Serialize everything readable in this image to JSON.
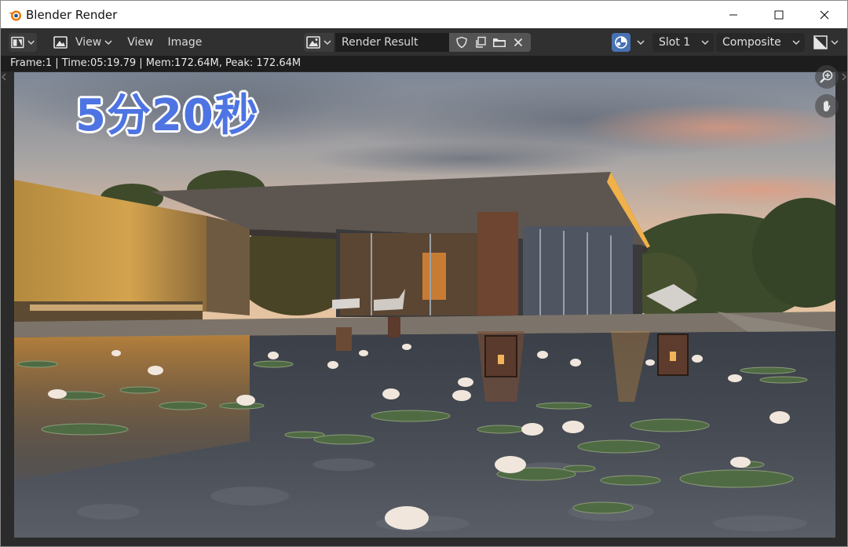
{
  "window": {
    "title": "Blender Render"
  },
  "header": {
    "menus": {
      "view1": "View",
      "view2": "View",
      "image": "Image"
    },
    "image_name": "Render Result",
    "slot": "Slot 1",
    "pass": "Composite"
  },
  "info": {
    "text": "Frame:1 | Time:05:19.79 | Mem:172.64M, Peak: 172.64M"
  },
  "overlay": {
    "caption": "5分20秒"
  },
  "colors": {
    "header_bg": "#303030",
    "accent_blue": "#4772b3",
    "caption": "#4d74e2"
  },
  "icons": {
    "logo": "blender-logo-icon",
    "editor_type": "image-editor-icon",
    "image_browse": "image-browse-icon",
    "fake_user": "shield-icon",
    "new_image": "duplicate-icon",
    "open_image": "folder-icon",
    "unlink": "close-icon",
    "display_channels": "display-channels-icon",
    "zoom": "zoom-icon",
    "pan": "hand-icon"
  }
}
